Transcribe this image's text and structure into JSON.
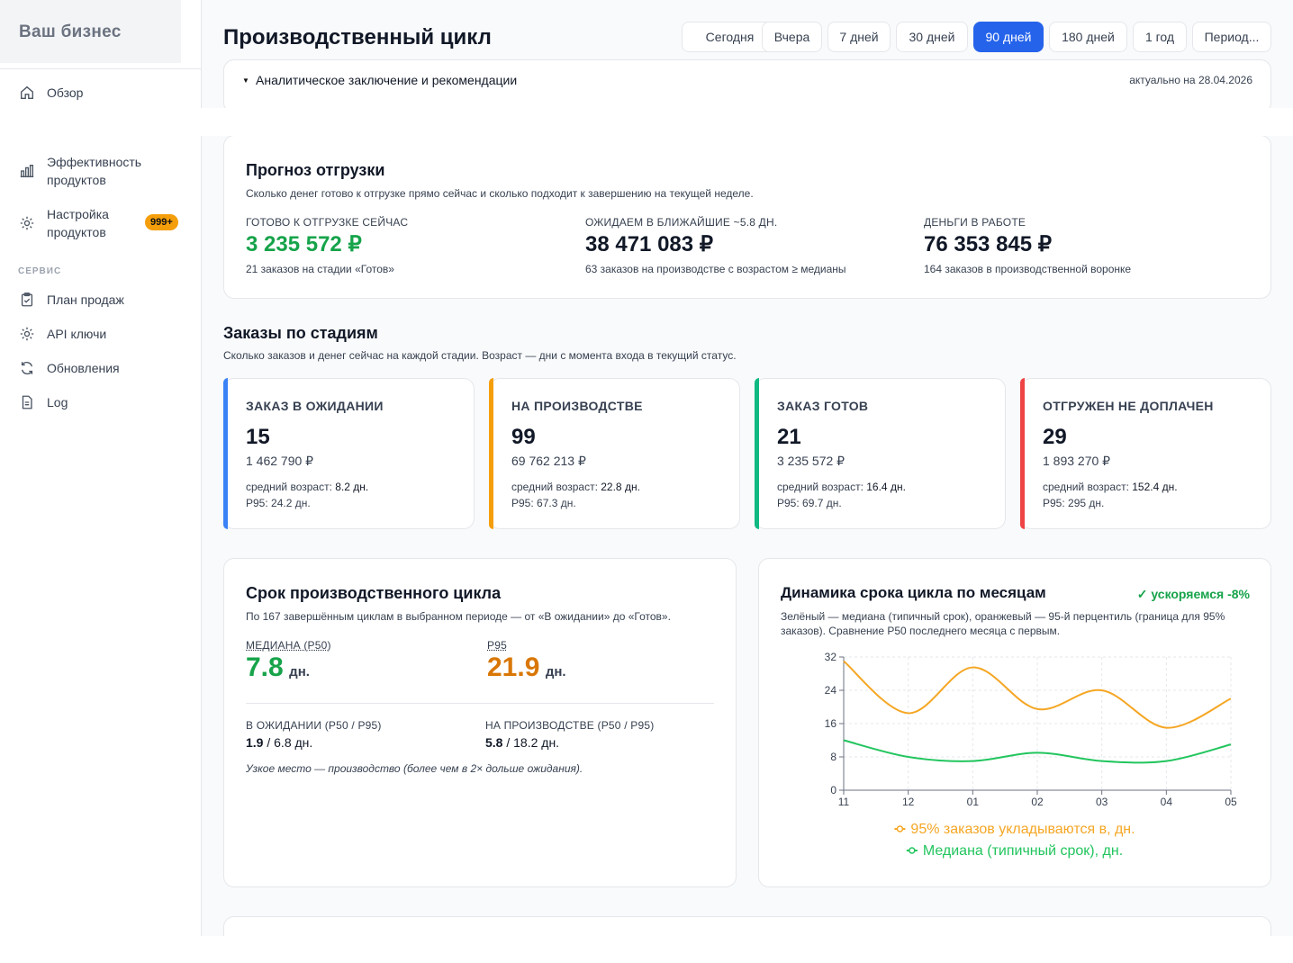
{
  "brand": "Ваш бизнес",
  "sidebar": {
    "items_top": [
      {
        "label": "Обзор",
        "icon": "home-icon"
      }
    ],
    "items_mid": [
      {
        "label": "Эффективность\nпродуктов",
        "icon": "bar-chart-icon"
      },
      {
        "label": "Настройка\nпродуктов",
        "icon": "gear-icon",
        "badge": "999+"
      }
    ],
    "section_service": "СЕРВИС",
    "items_service": [
      {
        "label": "План продаж",
        "icon": "clipboard-icon"
      },
      {
        "label": "API ключи",
        "icon": "gear-icon"
      },
      {
        "label": "Обновления",
        "icon": "refresh-icon"
      },
      {
        "label": "Log",
        "icon": "document-icon"
      }
    ]
  },
  "header": {
    "title": "Производственный цикл",
    "periods": [
      "Сегодня",
      "Вчера",
      "7 дней",
      "30 дней",
      "90 дней",
      "180 дней",
      "1 год",
      "Период..."
    ],
    "active_period": "90 дней"
  },
  "analytics": {
    "title": "Аналитическое заключение и рекомендации",
    "date": "актуально на 28.04.2026"
  },
  "forecast": {
    "title": "Прогноз отгрузки",
    "subtitle": "Сколько денег готово к отгрузке прямо сейчас и сколько подходит к завершению на текущей неделе.",
    "kpis": [
      {
        "label": "ГОТОВО К ОТГРУЗКЕ СЕЙЧАС",
        "value": "3 235 572 ₽",
        "note": "21 заказов на стадии «Готов»",
        "color": "#16a34a"
      },
      {
        "label": "ОЖИДАЕМ В БЛИЖАЙШИЕ ~5.8 ДН.",
        "value": "38 471 083 ₽",
        "note": "63 заказов на производстве с возрастом ≥ медианы",
        "color": "#111827"
      },
      {
        "label": "ДЕНЬГИ В РАБОТЕ",
        "value": "76 353 845 ₽",
        "note": "164 заказов в производственной воронке",
        "color": "#111827"
      }
    ]
  },
  "stages": {
    "title": "Заказы по стадиям",
    "subtitle": "Сколько заказов и денег сейчас на каждой стадии. Возраст — дни с момента входа в текущий статус.",
    "age_prefix": "средний возраст: ",
    "items": [
      {
        "name": "ЗАКАЗ В ОЖИДАНИИ",
        "count": "15",
        "amount": "1 462 790 ₽",
        "age": "8.2 дн.",
        "p95": "P95: 24.2 дн.",
        "color": "#3b82f6"
      },
      {
        "name": "НА ПРОИЗВОДСТВЕ",
        "count": "99",
        "amount": "69 762 213 ₽",
        "age": "22.8 дн.",
        "p95": "P95: 67.3 дн.",
        "color": "#f59e0b"
      },
      {
        "name": "ЗАКАЗ ГОТОВ",
        "count": "21",
        "amount": "3 235 572 ₽",
        "age": "16.4 дн.",
        "p95": "P95: 69.7 дн.",
        "color": "#10b981"
      },
      {
        "name": "ОТГРУЖЕН НЕ ДОПЛАЧЕН",
        "count": "29",
        "amount": "1 893 270 ₽",
        "age": "152.4 дн.",
        "p95": "P95: 295 дн.",
        "color": "#ef4444"
      }
    ]
  },
  "cycle": {
    "title": "Срок производственного цикла",
    "subtitle": "По 167 завершённым циклам в выбранном периоде — от «В ожидании» до «Готов».",
    "median_label": "МЕДИАНА (P50)",
    "median_value": "7.8",
    "p95_label": "P95",
    "p95_value": "21.9",
    "unit": "дн.",
    "waiting_label": "В ОЖИДАНИИ (P50 / P95)",
    "waiting_p50": "1.9",
    "waiting_rest": " / 6.8 дн.",
    "prod_label": "НА ПРОИЗВОДСТВЕ (P50 / P95)",
    "prod_p50": "5.8",
    "prod_rest": " / 18.2 дн.",
    "bottleneck": "Узкое место — производство (более чем в 2× дольше ожидания).",
    "colors": {
      "median": "#16a34a",
      "p95": "#d97706"
    }
  },
  "dynamics": {
    "title": "Динамика срока цикла по месяцам",
    "trend": "✓ ускоряемся -8%",
    "subtitle": "Зелёный — медиана (типичный срок), оранжевый — 95-й перцентиль (граница для 95% заказов). Сравнение P50 последнего месяца с первым."
  },
  "chart_data": {
    "type": "line",
    "categories": [
      "11",
      "12",
      "01",
      "02",
      "03",
      "04",
      "05"
    ],
    "series": [
      {
        "name": "95% заказов укладываются в, дн.",
        "values": [
          31,
          18.5,
          29.5,
          19.5,
          24,
          15,
          22
        ],
        "color": "#f5a623"
      },
      {
        "name": "Медиана (типичный срок), дн.",
        "values": [
          12,
          8,
          7,
          9,
          7,
          7,
          11
        ],
        "color": "#22c55e"
      }
    ],
    "yticks": [
      "0",
      "8",
      "16",
      "24",
      "32"
    ],
    "ylim": [
      0,
      32
    ],
    "grid": true,
    "legend": "bottom"
  }
}
